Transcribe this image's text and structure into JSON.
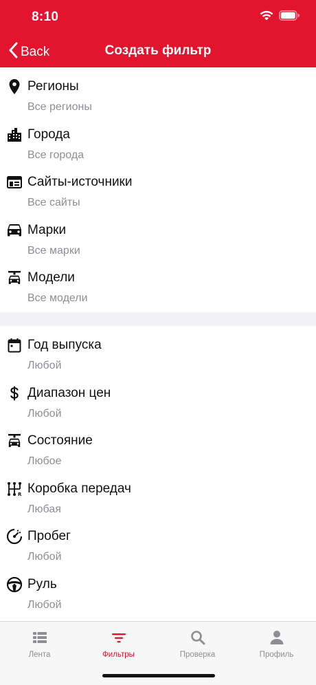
{
  "status": {
    "time": "8:10"
  },
  "nav": {
    "back_label": "Back",
    "title": "Создать фильтр"
  },
  "colors": {
    "accent": "#e3152e",
    "secondary_text": "#8e8e93",
    "divider": "#f2f2f4"
  },
  "filters_group1": [
    {
      "icon": "map-pin-icon",
      "title": "Регионы",
      "value": "Все регионы"
    },
    {
      "icon": "city-buildings-icon",
      "title": "Города",
      "value": "Все города"
    },
    {
      "icon": "website-icon",
      "title": "Сайты-источники",
      "value": "Все сайты"
    },
    {
      "icon": "car-icon",
      "title": "Марки",
      "value": "Все марки"
    },
    {
      "icon": "car-repair-icon",
      "title": "Модели",
      "value": "Все модели"
    }
  ],
  "filters_group2": [
    {
      "icon": "calendar-icon",
      "title": "Год выпуска",
      "value": "Любой"
    },
    {
      "icon": "dollar-icon",
      "title": "Диапазон цен",
      "value": "Любой"
    },
    {
      "icon": "car-repair-icon",
      "title": "Состояние",
      "value": "Любое"
    },
    {
      "icon": "gearbox-icon",
      "title": "Коробка передач",
      "value": "Любая"
    },
    {
      "icon": "speedometer-icon",
      "title": "Пробег",
      "value": "Любой"
    },
    {
      "icon": "steering-wheel-icon",
      "title": "Руль",
      "value": "Любой"
    }
  ],
  "tabs": [
    {
      "icon": "list-icon",
      "label": "Лента"
    },
    {
      "icon": "filter-icon",
      "label": "Фильтры"
    },
    {
      "icon": "search-icon",
      "label": "Проверка"
    },
    {
      "icon": "person-icon",
      "label": "Профиль"
    }
  ]
}
